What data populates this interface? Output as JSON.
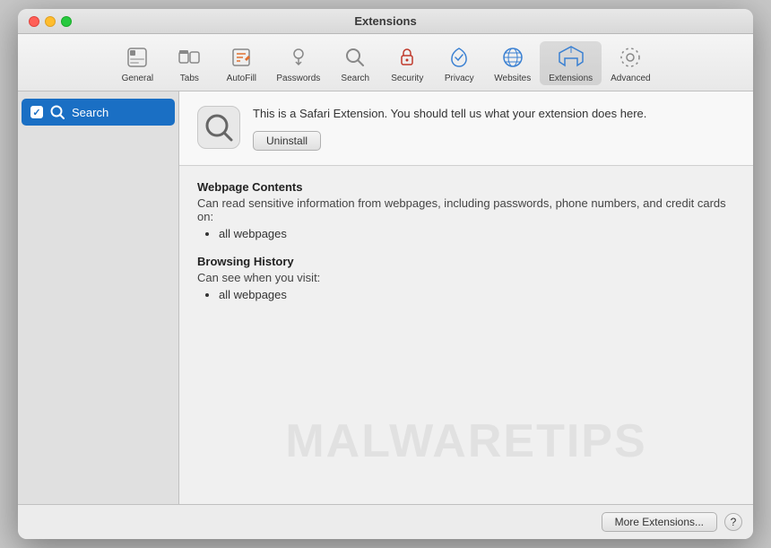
{
  "window": {
    "title": "Extensions"
  },
  "traffic_lights": {
    "close_label": "close",
    "minimize_label": "minimize",
    "maximize_label": "maximize"
  },
  "toolbar": {
    "items": [
      {
        "id": "general",
        "label": "General"
      },
      {
        "id": "tabs",
        "label": "Tabs"
      },
      {
        "id": "autofill",
        "label": "AutoFill"
      },
      {
        "id": "passwords",
        "label": "Passwords"
      },
      {
        "id": "search",
        "label": "Search"
      },
      {
        "id": "security",
        "label": "Security"
      },
      {
        "id": "privacy",
        "label": "Privacy"
      },
      {
        "id": "websites",
        "label": "Websites"
      },
      {
        "id": "extensions",
        "label": "Extensions"
      },
      {
        "id": "advanced",
        "label": "Advanced"
      }
    ]
  },
  "sidebar": {
    "items": [
      {
        "id": "search-ext",
        "label": "Search",
        "checked": true,
        "selected": true
      }
    ]
  },
  "detail": {
    "description": "This is a Safari Extension. You should tell us what your extension does here.",
    "uninstall_label": "Uninstall",
    "permissions": [
      {
        "title": "Webpage Contents",
        "description": "Can read sensitive information from webpages, including passwords, phone numbers, and credit cards on:",
        "items": [
          "all webpages"
        ]
      },
      {
        "title": "Browsing History",
        "description": "Can see when you visit:",
        "items": [
          "all webpages"
        ]
      }
    ]
  },
  "footer": {
    "more_extensions_label": "More Extensions...",
    "help_label": "?"
  },
  "watermark": {
    "text": "MALWARETIPS"
  }
}
